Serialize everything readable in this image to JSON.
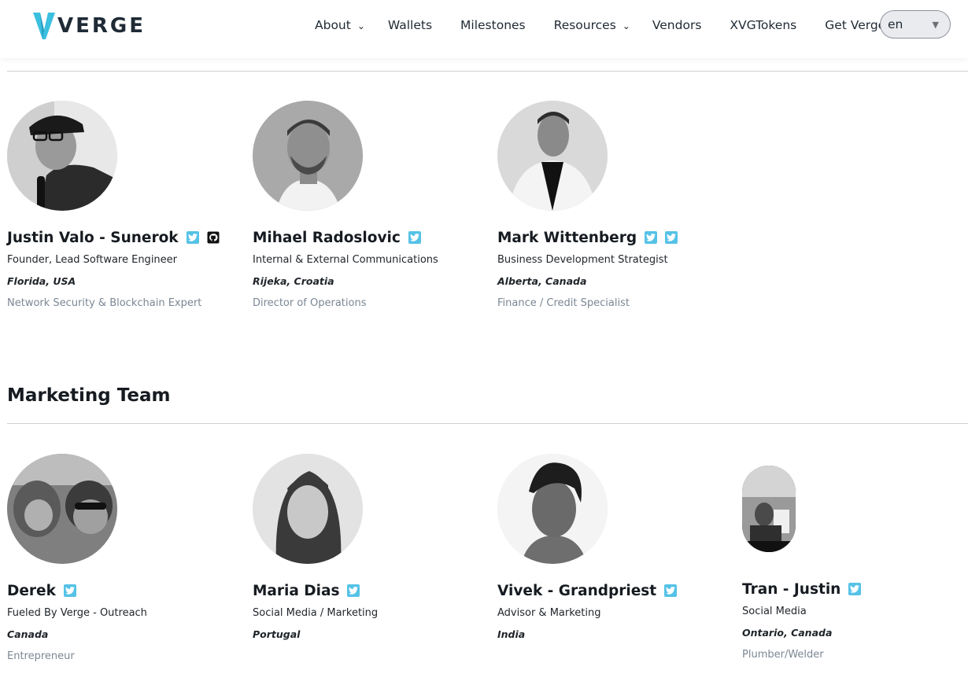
{
  "brand": {
    "name": "VERGE",
    "accent": "#3cc0e0"
  },
  "nav": {
    "items": [
      {
        "label": "About",
        "dropdown": true
      },
      {
        "label": "Wallets",
        "dropdown": false
      },
      {
        "label": "Milestones",
        "dropdown": false
      },
      {
        "label": "Resources",
        "dropdown": true
      },
      {
        "label": "Vendors",
        "dropdown": false
      },
      {
        "label": "XVGTokens",
        "dropdown": false
      },
      {
        "label": "Get Verge",
        "dropdown": false
      }
    ],
    "language": {
      "value": "en"
    }
  },
  "core_team": [
    {
      "name": "Justin Valo - Sunerok",
      "role": "Founder, Lead Software Engineer",
      "location": "Florida, USA",
      "specialty": "Network Security & Blockchain Expert",
      "socials": [
        "twitter-icon",
        "github-icon"
      ]
    },
    {
      "name": "Mihael Radoslovic",
      "role": "Internal & External Communications",
      "location": "Rijeka, Croatia",
      "specialty": "Director of Operations",
      "socials": [
        "twitter-icon"
      ]
    },
    {
      "name": "Mark Wittenberg",
      "role": "Business Development Strategist",
      "location": "Alberta, Canada",
      "specialty": "Finance / Credit Specialist",
      "socials": [
        "twitter-icon",
        "twitter-icon"
      ]
    }
  ],
  "marketing": {
    "title": "Marketing Team",
    "members": [
      {
        "name": "Derek",
        "role": "Fueled By Verge - Outreach",
        "location": "Canada",
        "specialty": "Entrepreneur",
        "socials": [
          "twitter-icon"
        ]
      },
      {
        "name": "Maria Dias",
        "role": "Social Media / Marketing",
        "location": "Portugal",
        "specialty": "",
        "socials": [
          "twitter-icon"
        ]
      },
      {
        "name": "Vivek - Grandpriest",
        "role": "Advisor & Marketing",
        "location": "India",
        "specialty": "",
        "socials": [
          "twitter-icon"
        ]
      },
      {
        "name": "Tran - Justin",
        "role": "Social Media",
        "location": "Ontario, Canada",
        "specialty": "Plumber/Welder",
        "socials": [
          "twitter-icon"
        ]
      }
    ]
  }
}
